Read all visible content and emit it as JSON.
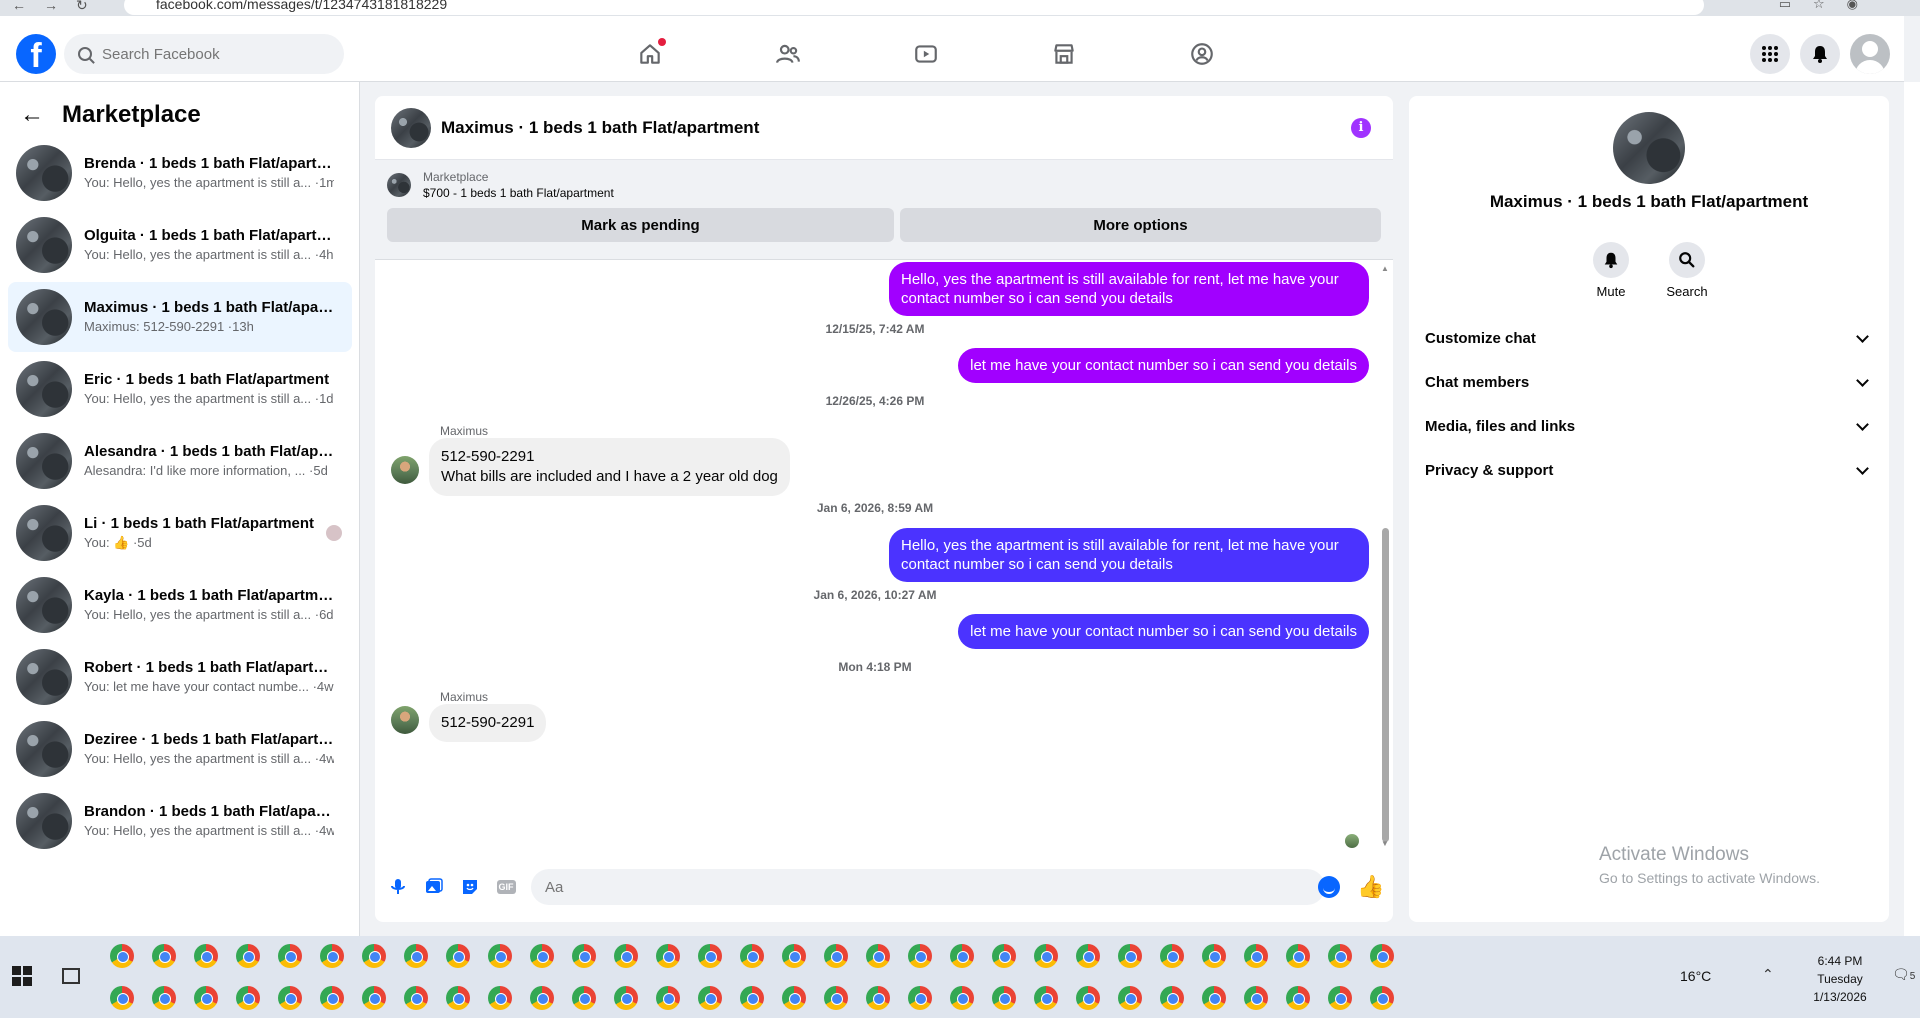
{
  "browser": {
    "url": "facebook.com/messages/t/1234743181818229"
  },
  "topbar": {
    "logo": "f",
    "search_placeholder": "Search Facebook",
    "nav_icons": [
      "home-icon",
      "friends-icon",
      "video-icon",
      "marketplace-icon",
      "groups-icon"
    ],
    "right_icons": [
      "menu-grid-icon",
      "bell-icon",
      "account-avatar"
    ]
  },
  "sidebar": {
    "title": "Marketplace",
    "conversations": [
      {
        "name": "Brenda · 1 beds 1 bath Flat/apartm...",
        "preview": "You: Hello, yes the apartment is still a... ·1m",
        "active": false
      },
      {
        "name": "Olguita · 1 beds 1 bath Flat/apartm...",
        "preview": "You: Hello, yes the apartment is still a... ·4h",
        "active": false
      },
      {
        "name": "Maximus · 1 beds 1 bath Flat/apart...",
        "preview": "Maximus: 512-590-2291 ·13h",
        "active": true
      },
      {
        "name": "Eric · 1 beds 1 bath Flat/apartment",
        "preview": "You: Hello, yes the apartment is still a... ·1d",
        "active": false
      },
      {
        "name": "Alesandra · 1 beds 1 bath Flat/apar...",
        "preview": "Alesandra: I'd like more information, ... ·5d",
        "active": false
      },
      {
        "name": "Li · 1 beds 1 bath Flat/apartment",
        "preview": "You: 👍 ·5d",
        "active": false
      },
      {
        "name": "Kayla · 1 beds 1 bath Flat/apartment",
        "preview": "You: Hello, yes the apartment is still a... ·6d",
        "active": false
      },
      {
        "name": "Robert · 1 beds 1 bath Flat/apartm...",
        "preview": "You: let me have your contact numbe... ·4w",
        "active": false
      },
      {
        "name": "Deziree · 1 beds 1 bath Flat/apartm...",
        "preview": "You: Hello, yes the apartment is still a... ·4w",
        "active": false
      },
      {
        "name": "Brandon · 1 beds 1 bath Flat/apart...",
        "preview": "You: Hello, yes the apartment is still a... ·4w",
        "active": false
      }
    ]
  },
  "chat": {
    "title": "Maximus · 1 beds 1 bath Flat/apartment",
    "marketplace": {
      "category": "Marketplace",
      "listing": "$700 - 1 beds 1 bath Flat/apartment",
      "pending_label": "Mark as pending",
      "more_label": "More options"
    },
    "messages": {
      "m1": "Hello, yes the apartment is still available for rent, let me have your contact number so i can send you details",
      "t1": "12/15/25, 7:42 AM",
      "m2": "let me have your contact number so i can send you details",
      "t2": "12/26/25, 4:26 PM",
      "sender1": "Maximus",
      "m3_line1": "512-590-2291",
      "m3_line2": "What bills are included and I have a 2 year old dog",
      "t3": "Jan 6, 2026, 8:59 AM",
      "m4": "Hello, yes the apartment is still available for rent, let me have your contact number so i can send you details",
      "t4": "Jan 6, 2026, 10:27 AM",
      "m5": "let me have your contact number so i can send you details",
      "t5": "Mon 4:18 PM",
      "sender2": "Maximus",
      "m6": "512-590-2291"
    },
    "composer": {
      "placeholder": "Aa",
      "gif_label": "GIF"
    },
    "colors": {
      "purple_bubble": "#a100ff",
      "blue_bubble": "#4b33ff",
      "accent": "#0866ff"
    }
  },
  "info_panel": {
    "name": "Maximus · 1 beds 1 bath Flat/apartment",
    "mute_label": "Mute",
    "search_label": "Search",
    "sections": [
      "Customize chat",
      "Chat members",
      "Media, files and links",
      "Privacy & support"
    ],
    "watermark_title": "Activate Windows",
    "watermark_sub": "Go to Settings to activate Windows."
  },
  "taskbar": {
    "temperature": "16°C",
    "time": "6:44 PM",
    "day": "Tuesday",
    "date": "1/13/2026",
    "notification_count": "5"
  }
}
